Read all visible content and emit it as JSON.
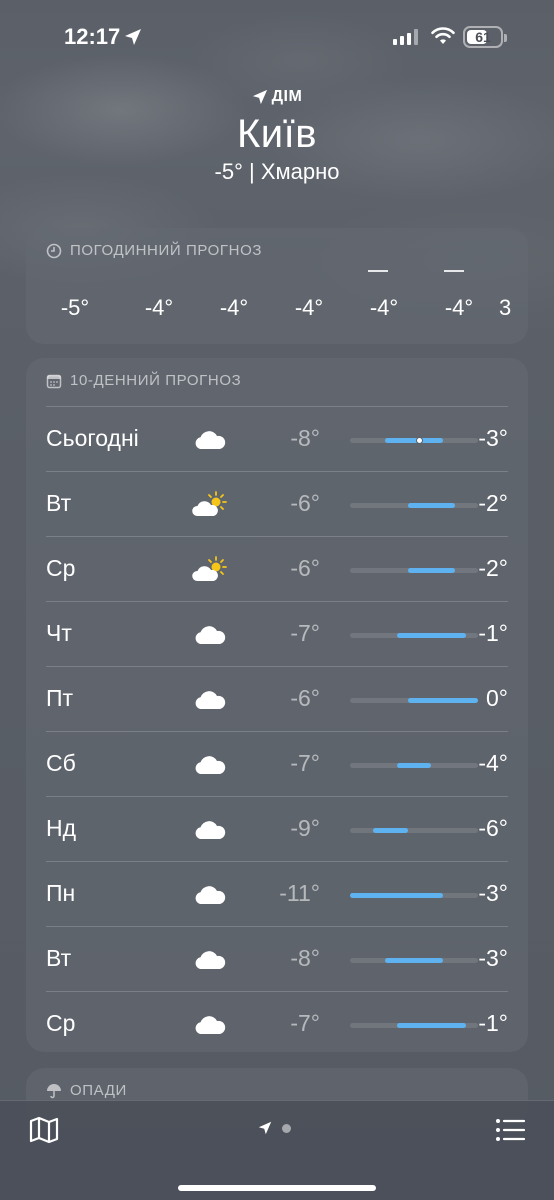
{
  "status_bar": {
    "time": "12:17",
    "battery": "61",
    "battery_level": 0.61
  },
  "header": {
    "location_label": "ДІМ",
    "city": "Київ",
    "summary": "-5°  |  Хмарно"
  },
  "hourly": {
    "title": "ПОГОДИННИЙ ПРОГНОЗ",
    "temps": [
      "-5°",
      "-4°",
      "-4°",
      "-4°",
      "-4°",
      "-4°",
      "3"
    ]
  },
  "daily": {
    "title": "10-ДЕННИЙ ПРОГНОЗ",
    "scale_min": -11,
    "scale_max": 0,
    "days": [
      {
        "name": "Сьогодні",
        "icon": "cloud-icon",
        "low": "-8°",
        "high": "-3°",
        "low_v": -8,
        "high_v": -3,
        "current": -5
      },
      {
        "name": "Вт",
        "icon": "partly-sunny-icon",
        "low": "-6°",
        "high": "-2°",
        "low_v": -6,
        "high_v": -2
      },
      {
        "name": "Ср",
        "icon": "partly-sunny-icon",
        "low": "-6°",
        "high": "-2°",
        "low_v": -6,
        "high_v": -2
      },
      {
        "name": "Чт",
        "icon": "cloud-icon",
        "low": "-7°",
        "high": "-1°",
        "low_v": -7,
        "high_v": -1
      },
      {
        "name": "Пт",
        "icon": "cloud-icon",
        "low": "-6°",
        "high": "0°",
        "low_v": -6,
        "high_v": 0
      },
      {
        "name": "Сб",
        "icon": "cloud-icon",
        "low": "-7°",
        "high": "-4°",
        "low_v": -7,
        "high_v": -4
      },
      {
        "name": "Нд",
        "icon": "cloud-icon",
        "low": "-9°",
        "high": "-6°",
        "low_v": -9,
        "high_v": -6
      },
      {
        "name": "Пн",
        "icon": "cloud-icon",
        "low": "-11°",
        "high": "-3°",
        "low_v": -11,
        "high_v": -3
      },
      {
        "name": "Вт",
        "icon": "cloud-icon",
        "low": "-8°",
        "high": "-3°",
        "low_v": -8,
        "high_v": -3
      },
      {
        "name": "Ср",
        "icon": "cloud-icon",
        "low": "-7°",
        "high": "-1°",
        "low_v": -7,
        "high_v": -1
      }
    ]
  },
  "precip": {
    "title": "ОПАДИ"
  },
  "colors": {
    "range_fill": "#5eb2f0",
    "sun": "#f5c518"
  }
}
